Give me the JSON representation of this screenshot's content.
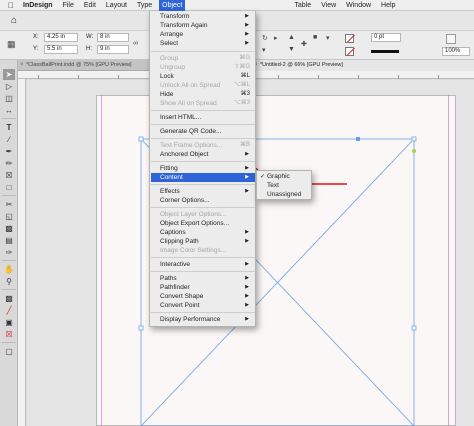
{
  "menubar": {
    "app": "InDesign",
    "items": [
      "File",
      "Edit",
      "Layout",
      "Type",
      "Object",
      "Table",
      "View",
      "Window",
      "Help"
    ],
    "active": "Object"
  },
  "control": {
    "x_label": "X:",
    "x_value": "4.25 in",
    "y_label": "Y:",
    "y_value": "5.5 in",
    "w_label": "W:",
    "w_value": "8 in",
    "h_label": "H:",
    "h_value": "9 in",
    "stroke_weight": "0 pt",
    "zoom": "100%"
  },
  "tabs": [
    {
      "label": "*ClassBallPrint.indd @ 75% [GPU Preview]",
      "active": false
    },
    {
      "label": "*Untitled-2 @ 66% [GPU Preview]",
      "active": true
    }
  ],
  "menu": {
    "items": [
      {
        "label": "Transform",
        "submenu": true
      },
      {
        "label": "Transform Again",
        "submenu": true
      },
      {
        "label": "Arrange",
        "submenu": true
      },
      {
        "label": "Select",
        "submenu": true
      },
      {
        "label": "Group",
        "shortcut": "⌘G",
        "disabled": true
      },
      {
        "label": "Ungroup",
        "shortcut": "⇧⌘G",
        "disabled": true
      },
      {
        "label": "Lock",
        "shortcut": "⌘L"
      },
      {
        "label": "Unlock All on Spread",
        "shortcut": "⌥⌘L",
        "disabled": true
      },
      {
        "label": "Hide",
        "shortcut": "⌘3"
      },
      {
        "label": "Show All on Spread",
        "shortcut": "⌥⌘3",
        "disabled": true
      },
      {
        "label": "Insert HTML..."
      },
      {
        "label": "Generate QR Code..."
      },
      {
        "label": "Text Frame Options...",
        "shortcut": "⌘B",
        "disabled": true
      },
      {
        "label": "Anchored Object",
        "submenu": true
      },
      {
        "label": "Fitting",
        "submenu": true
      },
      {
        "label": "Content",
        "submenu": true,
        "highlighted": true
      },
      {
        "label": "Effects",
        "submenu": true
      },
      {
        "label": "Corner Options..."
      },
      {
        "label": "Object Layer Options...",
        "disabled": true
      },
      {
        "label": "Object Export Options..."
      },
      {
        "label": "Captions",
        "submenu": true
      },
      {
        "label": "Clipping Path",
        "submenu": true
      },
      {
        "label": "Image Color Settings...",
        "disabled": true
      },
      {
        "label": "Interactive",
        "submenu": true
      },
      {
        "label": "Paths",
        "submenu": true
      },
      {
        "label": "Pathfinder",
        "submenu": true
      },
      {
        "label": "Convert Shape",
        "submenu": true
      },
      {
        "label": "Convert Point",
        "submenu": true
      },
      {
        "label": "Display Performance",
        "submenu": true
      }
    ]
  },
  "submenu": {
    "items": [
      {
        "label": "Graphic",
        "checked": true
      },
      {
        "label": "Text",
        "checked": false
      },
      {
        "label": "Unassigned",
        "checked": false
      }
    ]
  },
  "colors": {
    "menu_highlight": "#2e64d8",
    "annotation_arrow": "#e0161b",
    "frame_selection": "#6aa0e6"
  }
}
